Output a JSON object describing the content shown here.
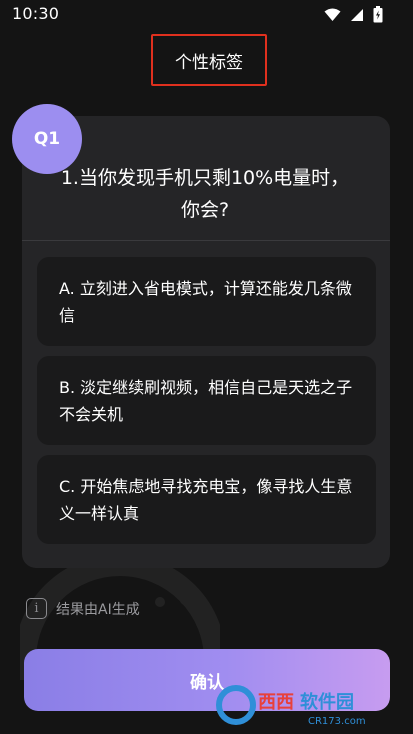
{
  "status_bar": {
    "time": "10:30",
    "icons": [
      "wifi-icon",
      "signal-icon",
      "battery-icon"
    ]
  },
  "header": {
    "title": "个性标签",
    "highlight_color": "#e0301e"
  },
  "question": {
    "badge": "Q1",
    "text": "1.当你发现手机只剩10%电量时，你会?",
    "badge_color": "#9c8ef0"
  },
  "options": [
    {
      "label": "A. 立刻进入省电模式，计算还能发几条微信"
    },
    {
      "label": "B. 淡定继续刷视频，相信自己是天选之子不会关机"
    },
    {
      "label": "C. 开始焦虑地寻找充电宝，像寻找人生意义一样认真"
    }
  ],
  "disclaimer": {
    "icon": "info-icon",
    "text": "结果由AI生成"
  },
  "confirm_button": {
    "label": "确认",
    "gradient": [
      "#8a7ee6",
      "#c79cf0"
    ]
  },
  "watermark": {
    "brand": "西西软件园",
    "url": "CR173.com"
  }
}
